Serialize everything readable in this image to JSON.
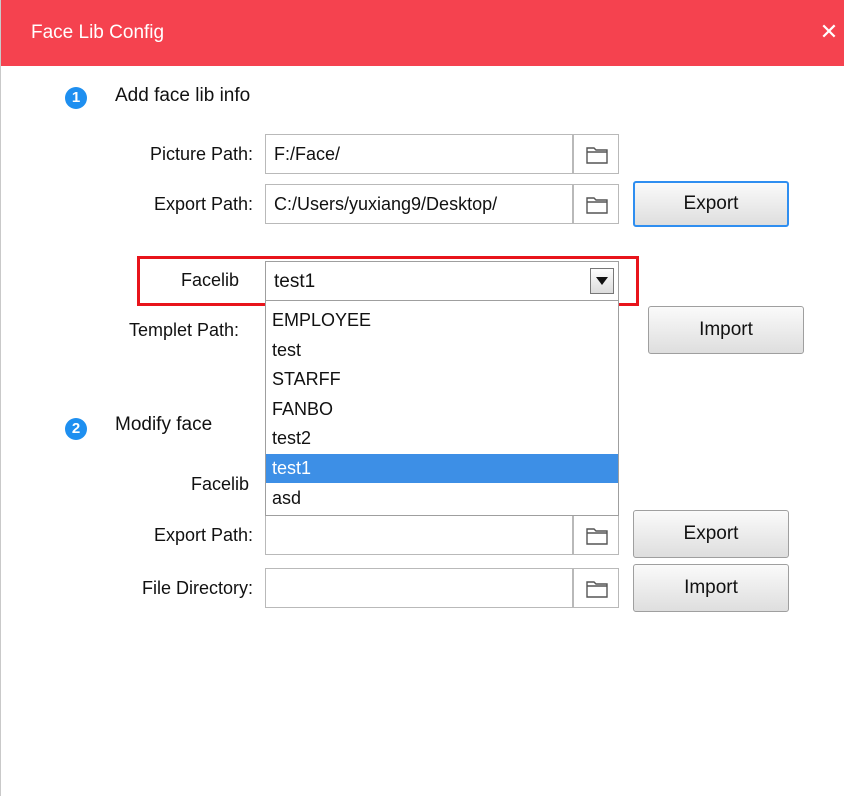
{
  "window": {
    "title": "Face Lib Config",
    "close_glyph": "✕"
  },
  "section1": {
    "number": "1",
    "title": "Add face lib info",
    "picture_path": {
      "label": "Picture Path:",
      "value": "F:/Face/"
    },
    "export_path": {
      "label": "Export Path:",
      "value": "C:/Users/yuxiang9/Desktop/",
      "button": "Export"
    },
    "facelib": {
      "label": "Facelib",
      "selected": "test1",
      "options": [
        "EMPLOYEE",
        "test",
        "STARFF",
        "FANBO",
        "test2",
        "test1",
        "asd"
      ]
    },
    "templet_path": {
      "label": "Templet Path:",
      "button": "Import"
    }
  },
  "section2": {
    "number": "2",
    "title": "Modify face",
    "facelib": {
      "label": "Facelib"
    },
    "export_path": {
      "label": "Export Path:",
      "value": "",
      "button": "Export"
    },
    "file_directory": {
      "label": "File Directory:",
      "value": "",
      "button": "Import"
    }
  },
  "icons": {
    "browse": "folder-icon",
    "close": "close-icon",
    "dropdown": "chevron-down-icon"
  },
  "colors": {
    "titlebar": "#f5424f",
    "step_badge": "#1e8ff0",
    "selection": "#3d8fe6",
    "highlight_border": "#e8141b"
  }
}
